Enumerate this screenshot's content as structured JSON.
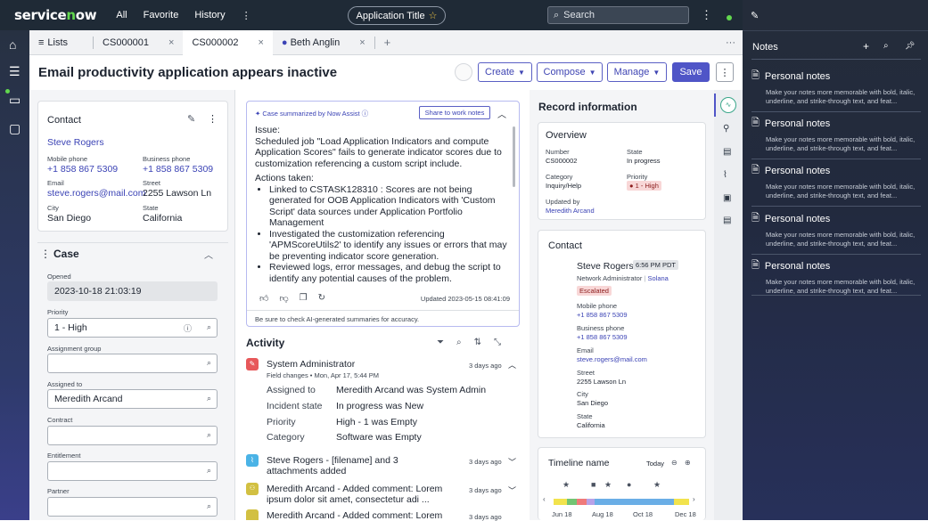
{
  "topbar": {
    "logo": "servicenow",
    "nav": [
      "All",
      "Favorite",
      "History"
    ],
    "app_title": "Application Title",
    "search_placeholder": "Search"
  },
  "tabs": [
    {
      "label": "Lists"
    },
    {
      "label": "CS000001"
    },
    {
      "label": "CS000002"
    },
    {
      "label": "Beth Anglin"
    }
  ],
  "header": {
    "title": "Email productivity application appears inactive",
    "buttons": {
      "create": "Create",
      "compose": "Compose",
      "manage": "Manage",
      "save": "Save"
    }
  },
  "contact_card": {
    "heading": "Contact",
    "name": "Steve Rogers",
    "mobile_label": "Mobile phone",
    "mobile": "+1 858 867 5309",
    "business_label": "Business phone",
    "business": "+1 858 867 5309",
    "email_label": "Email",
    "email": "steve.rogers@mail.com",
    "street_label": "Street",
    "street": "2255 Lawson Ln",
    "city_label": "City",
    "city": "San Diego",
    "state_label": "State",
    "state": "California"
  },
  "case": {
    "heading": "Case",
    "opened_label": "Opened",
    "opened": "2023-10-18 21:03:19",
    "priority_label": "Priority",
    "priority": "1 - High",
    "assignment_group_label": "Assignment group",
    "assignment_group": "",
    "assigned_to_label": "Assigned to",
    "assigned_to": "Meredith Arcand",
    "contract_label": "Contract",
    "contract": "",
    "entitlement_label": "Entitlement",
    "entitlement": "",
    "partner_label": "Partner",
    "partner": ""
  },
  "summary": {
    "header": "Case summarized by Now Assist",
    "share_button": "Share to work notes",
    "issue_title": "Issue:",
    "issue_text": "Scheduled job \"Load Application Indicators and compute Application Scores\" fails to generate indicator scores due to customization referencing a custom script include.",
    "actions_title": "Actions taken:",
    "actions": [
      "Linked to CSTASK128310 : Scores are not being generated for OOB Application Indicators with  'Custom Script' data sources under Application Portfolio Management",
      "Investigated the customization referencing 'APMScoreUtils2' to identify any issues or errors that may be preventing indicator score generation.",
      "Reviewed logs, error messages, and debug the script to identify any potential causes of the problem."
    ],
    "updated": "Updated 2023-05-15 08:41:09",
    "footer": "Be sure to check AI-generated summaries for accuracy."
  },
  "activity": {
    "heading": "Activity",
    "entries": [
      {
        "author": "System Administrator",
        "sub": "Field changes  •  Mon, Apr 17, 5:44 PM",
        "time": "3 days ago",
        "changes": [
          {
            "field": "Assigned to",
            "value": "Meredith Arcand was System Admin"
          },
          {
            "field": "Incident state",
            "value": "In progress was New"
          },
          {
            "field": "Priority",
            "value": "High - 1 was Empty"
          },
          {
            "field": "Category",
            "value": "Software was Empty"
          }
        ]
      },
      {
        "author": "Steve Rogers",
        "text": " - [filename] and 3 attachments added",
        "time": "3 days ago"
      },
      {
        "author": "Meredith Arcand",
        "text": " - Added comment: Lorem ipsum dolor sit amet, consectetur adi ...",
        "time": "3 days ago"
      },
      {
        "author": "Meredith Arcand",
        "text": " - Added comment: Lorem",
        "time": "3 days ago"
      }
    ]
  },
  "record": {
    "heading": "Record information",
    "overview": {
      "heading": "Overview",
      "number_label": "Number",
      "number": "CS000002",
      "state_label": "State",
      "state": "In progress",
      "category_label": "Category",
      "category": "Inquiry/Help",
      "priority_label": "Priority",
      "priority": "1 - High",
      "updated_by_label": "Updated by",
      "updated_by": "Meredith Arcand"
    },
    "contact": {
      "heading": "Contact",
      "name": "Steve Rogers",
      "time_badge": "6:56 PM PDT",
      "role": "Network Administrator",
      "company": "Solana",
      "status": "Escalated",
      "mobile_label": "Mobile phone",
      "mobile": "+1 858 867 5309",
      "business_label": "Business phone",
      "business": "+1 858 867 5309",
      "email_label": "Email",
      "email": "steve.rogers@mail.com",
      "street_label": "Street",
      "street": "2255 Lawson Ln",
      "city_label": "City",
      "city": "San Diego",
      "state_label": "State",
      "state": "California"
    },
    "timeline": {
      "heading": "Timeline name",
      "today": "Today",
      "ticks": [
        "Jun 18",
        "Aug 18",
        "Oct 18",
        "Dec 18"
      ]
    }
  },
  "notes": {
    "heading": "Notes",
    "items": [
      {
        "title": "Personal notes",
        "desc": "Make your notes more memorable with bold, italic, underline, and strike-through text, and feat..."
      },
      {
        "title": "Personal notes",
        "desc": "Make your notes more memorable with bold, italic, underline, and strike-through text, and feat..."
      },
      {
        "title": "Personal notes",
        "desc": "Make your notes more memorable with bold, italic, underline, and strike-through text, and feat..."
      },
      {
        "title": "Personal notes",
        "desc": "Make your notes more memorable with bold, italic, underline, and strike-through text, and feat..."
      },
      {
        "title": "Personal notes",
        "desc": "Make your notes more memorable with bold, italic, underline, and strike-through text, and feat..."
      }
    ]
  },
  "colors": {
    "brand_green": "#62d84e",
    "accent": "#4f55c7",
    "topbar": "#1f2a36"
  }
}
